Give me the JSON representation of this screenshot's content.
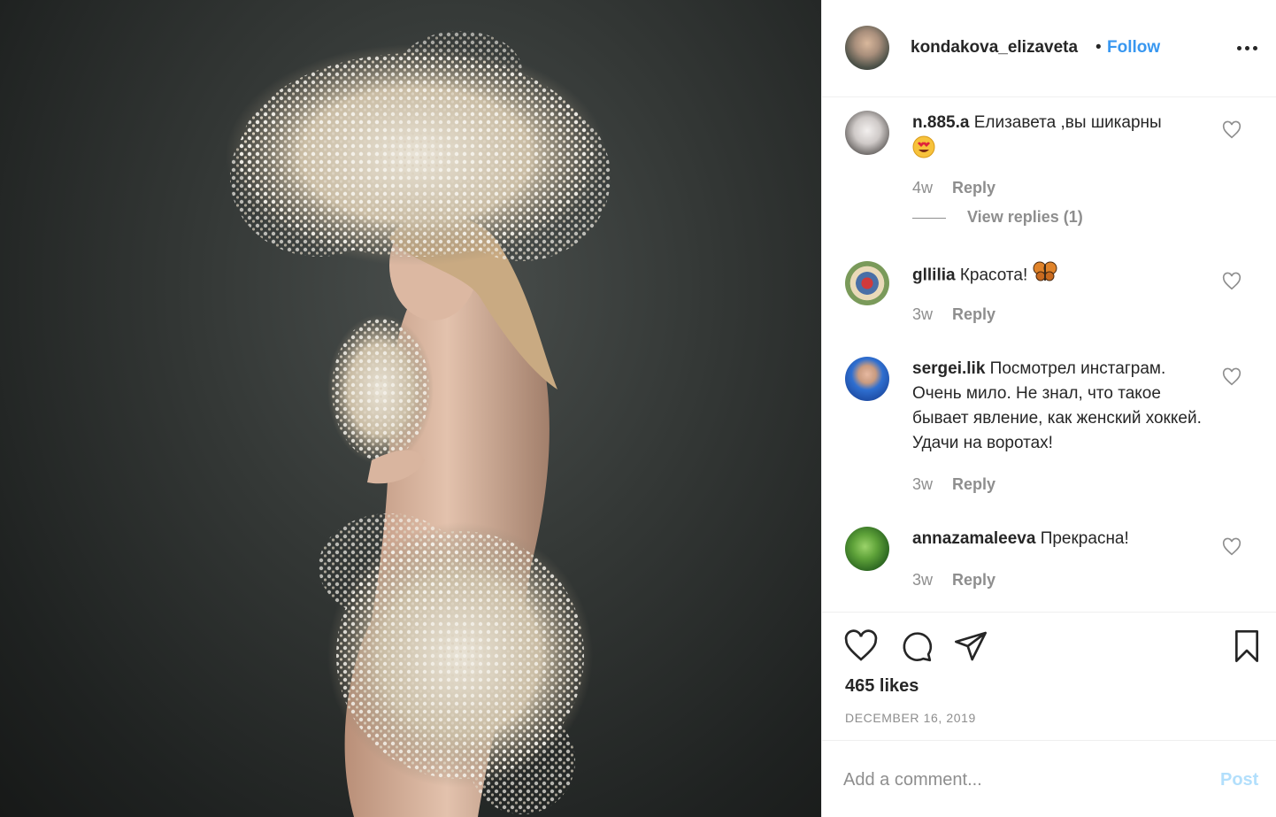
{
  "post": {
    "author": "kondakova_elizaveta",
    "separator": "•",
    "follow_label": "Follow",
    "more_icon": "more-horizontal-icon"
  },
  "comments": [
    {
      "username": "n.885.a",
      "text": "Елизавета ,вы шикарны",
      "emoji": "heart-eyes-emoji",
      "age": "4w",
      "reply_label": "Reply",
      "view_replies": "View replies (1)"
    },
    {
      "username": "gllilia",
      "text": "Красота!",
      "emoji": "butterfly-emoji",
      "age": "3w",
      "reply_label": "Reply"
    },
    {
      "username": "sergei.lik",
      "text": "Посмотрел инстаграм. Очень мило. Не знал, что такое бывает явление, как женский хоккей. Удачи на воротах!",
      "age": "3w",
      "reply_label": "Reply"
    },
    {
      "username": "annazamaleeva",
      "text": "Прекрасна!",
      "age": "3w",
      "reply_label": "Reply"
    }
  ],
  "actions": {
    "icons": [
      "heart-icon",
      "comment-icon",
      "share-icon",
      "bookmark-icon"
    ],
    "likes": "465 likes",
    "date": "DECEMBER 16, 2019"
  },
  "add_comment": {
    "placeholder": "Add a comment...",
    "post_label": "Post"
  },
  "colors": {
    "accent": "#3897f0",
    "post_disabled": "#b2dffc",
    "muted": "#8e8e8e",
    "text": "#262626"
  }
}
